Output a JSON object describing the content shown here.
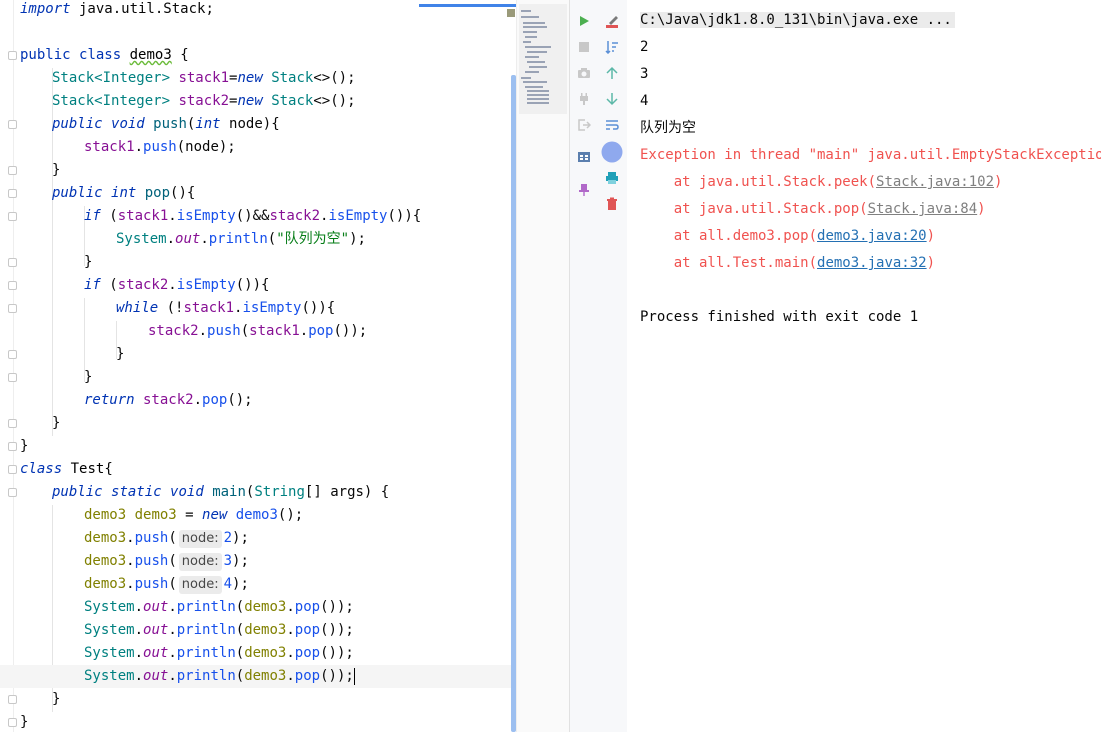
{
  "editor": {
    "lines": {
      "l0": {
        "kw": "import",
        "rest": " java.util.Stack;"
      },
      "l1": {
        "kw1": "public",
        "kw2": "class",
        "name": "demo3",
        "rest": " {"
      },
      "l2": {
        "t1": "Stack",
        "gen": "<Integer>",
        "f": "stack1",
        "eq": "=",
        "kw": "new",
        "t2": "Stack",
        "rest": "<>();"
      },
      "l3": {
        "t1": "Stack",
        "gen": "<Integer>",
        "f": "stack2",
        "eq": "=",
        "kw": "new",
        "t2": "Stack",
        "rest": "<>();"
      },
      "l4": {
        "kw1": "public",
        "kw2": "void",
        "fn": "push",
        "p1": "(",
        "kw3": "int",
        "rest": " node){"
      },
      "l5": {
        "f": "stack1",
        "dot": ".",
        "m": "push",
        "rest": "(node);"
      },
      "l6": {
        "text": "}"
      },
      "l7": {
        "kw1": "public",
        "kw2": "int",
        "fn": "pop",
        "rest": "(){"
      },
      "l8": {
        "kw": "if",
        "p": " (",
        "f1": "stack1",
        "d1": ".",
        "m1": "isEmpty",
        "mid": "()&&",
        "f2": "stack2",
        "d2": ".",
        "m2": "isEmpty",
        "rest": "()){"
      },
      "l9": {
        "sys": "System",
        "d1": ".",
        "out": "out",
        "d2": ".",
        "m": "println",
        "p1": "(",
        "str": "\"队列为空\"",
        "rest": ");"
      },
      "l10": {
        "text": "}"
      },
      "l11": {
        "kw": "if",
        "p": " (",
        "f": "stack2",
        "d": ".",
        "m": "isEmpty",
        "rest": "()){"
      },
      "l12": {
        "kw": "while",
        "p": " (!",
        "f": "stack1",
        "d": ".",
        "m": "isEmpty",
        "rest": "()){"
      },
      "l13": {
        "f1": "stack2",
        "d1": ".",
        "m1": "push",
        "p": "(",
        "f2": "stack1",
        "d2": ".",
        "m2": "pop",
        "rest": "());"
      },
      "l14": {
        "text": "}"
      },
      "l15": {
        "text": "}"
      },
      "l16": {
        "kw": "return",
        "f": " stack2",
        "d": ".",
        "m": "pop",
        "rest": "();"
      },
      "l17": {
        "text": "}"
      },
      "l18": {
        "text": "}"
      },
      "l19": {
        "kw": "class",
        "name": " Test",
        "rest": "{"
      },
      "l20": {
        "kw1": "public",
        "kw2": "static",
        "kw3": "void",
        "fn": "main",
        "p": "(",
        "t": "String",
        "rest": "[] args) {"
      },
      "l21": {
        "v1": "demo3",
        "v2": " demo3",
        "eq": " = ",
        "kw": "new",
        "t": " demo3",
        "rest": "();"
      },
      "l22": {
        "v": "demo3",
        "d": ".",
        "m": "push",
        "p": "(",
        "hint": "node:",
        "num": "2",
        "rest": ");"
      },
      "l23": {
        "v": "demo3",
        "d": ".",
        "m": "push",
        "p": "(",
        "hint": "node:",
        "num": "3",
        "rest": ");"
      },
      "l24": {
        "v": "demo3",
        "d": ".",
        "m": "push",
        "p": "(",
        "hint": "node:",
        "num": "4",
        "rest": ");"
      },
      "l25": {
        "sys": "System",
        "d1": ".",
        "out": "out",
        "d2": ".",
        "m": "println",
        "p": "(",
        "v": "demo3",
        "d3": ".",
        "m2": "pop",
        "rest": "());"
      },
      "l26": {
        "sys": "System",
        "d1": ".",
        "out": "out",
        "d2": ".",
        "m": "println",
        "p": "(",
        "v": "demo3",
        "d3": ".",
        "m2": "pop",
        "rest": "());"
      },
      "l27": {
        "sys": "System",
        "d1": ".",
        "out": "out",
        "d2": ".",
        "m": "println",
        "p": "(",
        "v": "demo3",
        "d3": ".",
        "m2": "pop",
        "rest": "());"
      },
      "l28": {
        "sys": "System",
        "d1": ".",
        "out": "out",
        "d2": ".",
        "m": "println",
        "p": "(",
        "v": "demo3",
        "d3": ".",
        "m2": "pop",
        "rest": "());"
      },
      "l29": {
        "text": "}"
      },
      "l30": {
        "text": "}"
      }
    }
  },
  "toolbar": {
    "icons": [
      "run-icon",
      "stop-icon",
      "camera-icon",
      "plug-icon",
      "exit-icon",
      "layout-icon",
      "pin-icon",
      "rerun-icon",
      "sort-icon",
      "up-arrow-icon",
      "down-arrow-icon",
      "soft-wrap-icon",
      "circle-icon",
      "print-icon",
      "trash-icon"
    ],
    "colors": {
      "run": "#4caf50",
      "rerun": "#e05555",
      "accent": "#3574f0",
      "print": "#20a0b8",
      "trash": "#e05555",
      "pin": "#b169c9"
    }
  },
  "console": {
    "cmd": "C:\\Java\\jdk1.8.0_131\\bin\\java.exe ...",
    "out1": "2",
    "out2": "3",
    "out3": "4",
    "out4": "队列为空",
    "exception": "Exception in thread \"main\" java.util.EmptyStackException",
    "st1_pre": "    at java.util.Stack.peek(",
    "st1_link": "Stack.java:102",
    "st1_post": ")",
    "st2_pre": "    at java.util.Stack.pop(",
    "st2_link": "Stack.java:84",
    "st2_post": ")",
    "st3_pre": "    at all.demo3.pop(",
    "st3_link": "demo3.java:20",
    "st3_post": ")",
    "st4_pre": "    at all.Test.main(",
    "st4_link": "demo3.java:32",
    "st4_post": ")",
    "finish": "Process finished with exit code 1"
  }
}
